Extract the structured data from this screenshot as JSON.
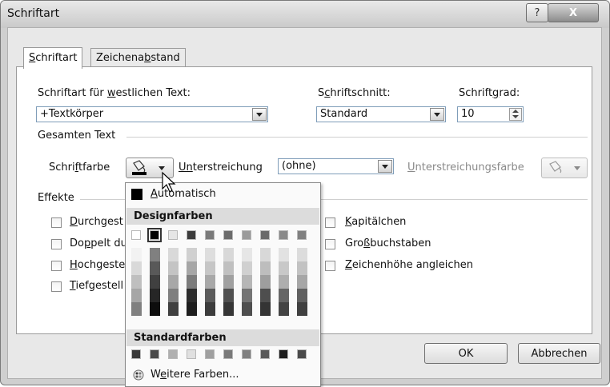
{
  "window": {
    "title": "Schriftart",
    "help_label": "?",
    "close_label": "X"
  },
  "tabs": [
    {
      "mnemonic": "S",
      "rest": "chriftart"
    },
    {
      "pre": "Zeichena",
      "mnemonic": "b",
      "rest": "stand"
    }
  ],
  "fields": {
    "latin_font": {
      "pre": "Schriftart für ",
      "mnemonic": "w",
      "rest": "estlichen Text:",
      "value": "+Textkörper"
    },
    "style": {
      "pre": "S",
      "mnemonic": "c",
      "rest": "hriftschnitt:",
      "value": "Standard"
    },
    "size": {
      "pre": "Schrift",
      "mnemonic": "g",
      "rest": "rad:",
      "value": "10"
    }
  },
  "all_text": {
    "heading": "Gesamten Text",
    "font_color": {
      "pre": "Schri",
      "mnemonic": "f",
      "rest": "tfarbe"
    },
    "underline": {
      "pre": "U",
      "mnemonic": "n",
      "rest": "terstreichung",
      "value": "(ohne)"
    },
    "underline_color": {
      "pre": "",
      "mnemonic": "U",
      "rest": "nterstreichungsfarbe"
    }
  },
  "effects": {
    "heading": "Effekte",
    "left": [
      {
        "mnemonic": "D",
        "rest": "urchgest"
      },
      {
        "pre": "Do",
        "mnemonic": "p",
        "rest": "pelt du"
      },
      {
        "mnemonic": "H",
        "rest": "ochgeste"
      },
      {
        "mnemonic": "T",
        "rest": "iefgestell"
      }
    ],
    "right": [
      {
        "mnemonic": "K",
        "rest": "apitälchen"
      },
      {
        "pre": "Gro",
        "mnemonic": "ß",
        "rest": "buchstaben"
      },
      {
        "mnemonic": "Z",
        "rest": "eichenhöhe angleichen"
      }
    ]
  },
  "buttons": {
    "ok": "OK",
    "cancel": "Abbrechen"
  },
  "color_menu": {
    "automatic": {
      "mnemonic": "A",
      "rest": "utomatisch"
    },
    "theme_heading": "Designfarben",
    "standard_heading": "Standardfarben",
    "more": {
      "pre": "W",
      "mnemonic": "e",
      "rest": "itere Farben..."
    },
    "theme_top": [
      "#ffffff",
      "#000000",
      "#e6e6e6",
      "#3c3c3c",
      "#7a7a7a",
      "#6c6c6c",
      "#9a9a9a",
      "#6a6a6a",
      "#8a8a8a",
      "#808080"
    ],
    "theme_shades": [
      [
        "#f2f2f2",
        "#808080",
        "#d9d9d9",
        "#d0d0d0",
        "#dedede",
        "#d8d8d8",
        "#e6e6e6",
        "#d8d8d8",
        "#e2e2e2",
        "#dcdcdc"
      ],
      [
        "#d9d9d9",
        "#595959",
        "#c4c4c4",
        "#a6a6a6",
        "#c6c6c6",
        "#c0c0c0",
        "#d0d0d0",
        "#bdbdbd",
        "#c8c8c8",
        "#c2c2c2"
      ],
      [
        "#bfbfbf",
        "#404040",
        "#a8a8a8",
        "#7c7c7c",
        "#a8a8a8",
        "#a0a0a0",
        "#b6b6b6",
        "#9e9e9e",
        "#aeaeae",
        "#a6a6a6"
      ],
      [
        "#a6a6a6",
        "#262626",
        "#7f7f7f",
        "#2d2d2d",
        "#5b5b5b",
        "#505050",
        "#747474",
        "#4e4e4e",
        "#666666",
        "#606060"
      ],
      [
        "#808080",
        "#0d0d0d",
        "#404040",
        "#1e1e1e",
        "#3c3c3c",
        "#363636",
        "#4e4e4e",
        "#343434",
        "#444444",
        "#404040"
      ]
    ],
    "standard": [
      "#3a3a3a",
      "#4a4a4a",
      "#b0b0b0",
      "#e0e0e0",
      "#a0a0a0",
      "#7a7a7a",
      "#808080",
      "#5a5a5a",
      "#1e1e1e",
      "#4a4a4a"
    ]
  }
}
